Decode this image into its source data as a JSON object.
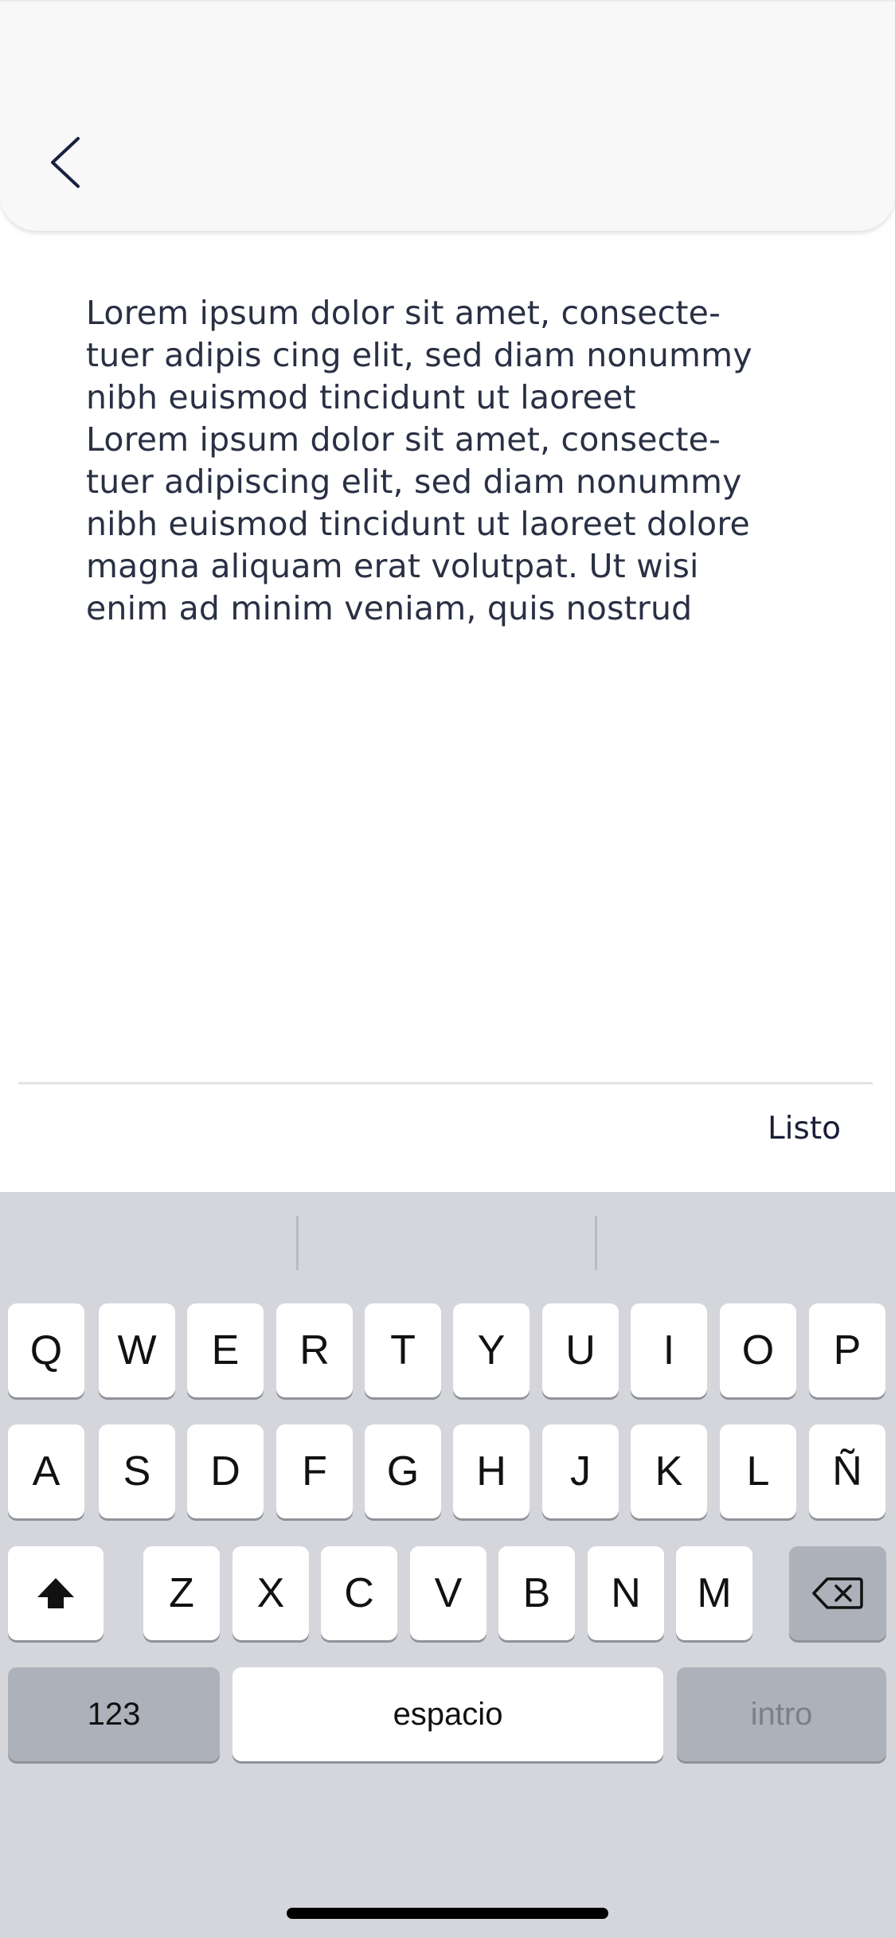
{
  "header": {
    "back_icon": "chevron-left-icon"
  },
  "content": {
    "text": "Lorem ipsum dolor sit amet, consecte-\ntuer adipis cing elit, sed diam nonummy\nnibh euismod tincidunt ut laoreet\nLorem ipsum dolor sit amet, consecte-\ntuer adipiscing elit, sed diam nonummy\nnibh euismod tincidunt ut laoreet dolore\nmagna aliquam erat volutpat. Ut wisi\nenim ad minim veniam, quis nostrud"
  },
  "toolbar": {
    "done_label": "Listo"
  },
  "keyboard": {
    "row1": [
      "Q",
      "W",
      "E",
      "R",
      "T",
      "Y",
      "U",
      "I",
      "O",
      "P"
    ],
    "row2": [
      "A",
      "S",
      "D",
      "F",
      "G",
      "H",
      "J",
      "K",
      "L",
      "Ñ"
    ],
    "row3": [
      "Z",
      "X",
      "C",
      "V",
      "B",
      "N",
      "M"
    ],
    "shift_icon": "shift-arrow-icon",
    "delete_icon": "backspace-icon",
    "numbers_label": "123",
    "space_label": "espacio",
    "return_label": "intro"
  },
  "colors": {
    "header_bg": "#f8f8f9",
    "text": "#2a3044",
    "keyboard_bg": "#d4d6dc",
    "key_bg": "#ffffff",
    "key_dark_bg": "#adb1b9"
  }
}
